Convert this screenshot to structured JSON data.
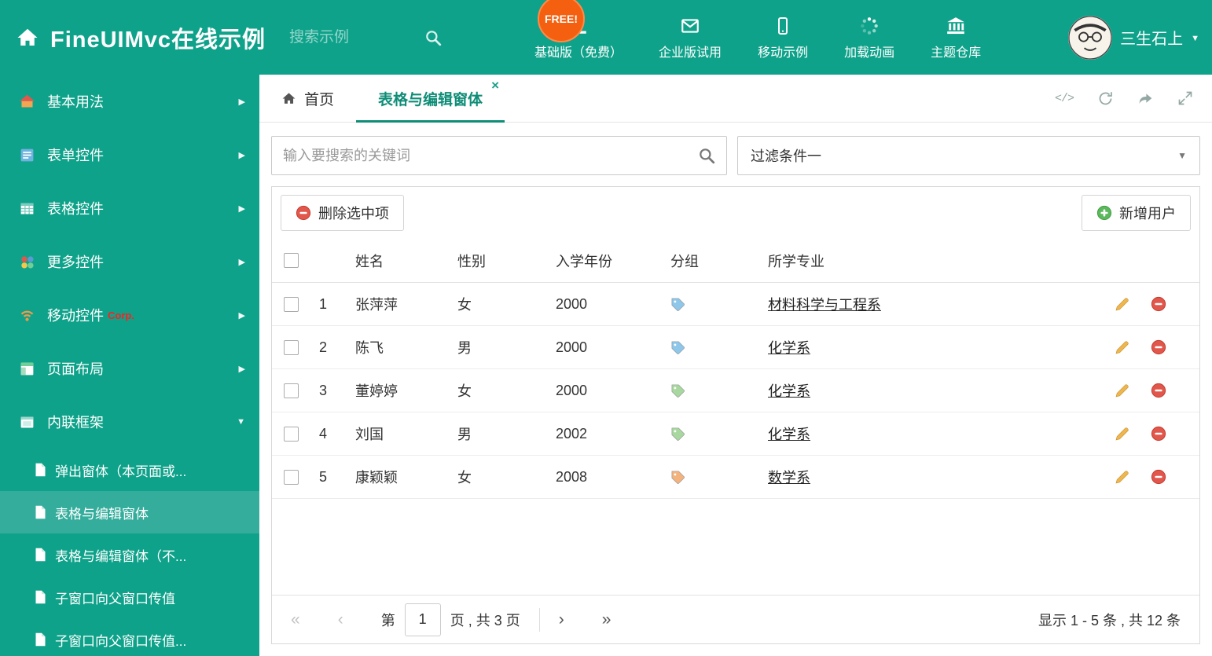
{
  "header": {
    "title": "FineUIMvc在线示例",
    "search_placeholder": "搜索示例",
    "free_badge": "FREE!",
    "nav": [
      {
        "label": "基础版（免费）"
      },
      {
        "label": "企业版试用"
      },
      {
        "label": "移动示例"
      },
      {
        "label": "加载动画"
      },
      {
        "label": "主题仓库"
      }
    ],
    "user_name": "三生石上"
  },
  "sidebar": {
    "items": [
      {
        "label": "基本用法"
      },
      {
        "label": "表单控件"
      },
      {
        "label": "表格控件"
      },
      {
        "label": "更多控件"
      },
      {
        "label": "移动控件",
        "tag": "Corp."
      },
      {
        "label": "页面布局"
      },
      {
        "label": "内联框架"
      }
    ],
    "subitems": [
      {
        "label": "弹出窗体（本页面或..."
      },
      {
        "label": "表格与编辑窗体"
      },
      {
        "label": "表格与编辑窗体（不..."
      },
      {
        "label": "子窗口向父窗口传值"
      },
      {
        "label": "子窗口向父窗口传值..."
      }
    ]
  },
  "tabs": {
    "home": "首页",
    "active": "表格与编辑窗体",
    "close": "×"
  },
  "filter": {
    "keyword_placeholder": "输入要搜索的关键词",
    "dropdown_value": "过滤条件一"
  },
  "toolbar": {
    "delete_label": "删除选中项",
    "add_label": "新增用户"
  },
  "table": {
    "headers": {
      "name": "姓名",
      "gender": "性别",
      "year": "入学年份",
      "group": "分组",
      "major": "所学专业"
    },
    "rows": [
      {
        "num": "1",
        "name": "张萍萍",
        "gender": "女",
        "year": "2000",
        "tag_color": "#8ec7ea",
        "major": "材料科学与工程系"
      },
      {
        "num": "2",
        "name": "陈飞",
        "gender": "男",
        "year": "2000",
        "tag_color": "#8ec7ea",
        "major": "化学系"
      },
      {
        "num": "3",
        "name": "董婷婷",
        "gender": "女",
        "year": "2000",
        "tag_color": "#a8d8a0",
        "major": "化学系"
      },
      {
        "num": "4",
        "name": "刘国",
        "gender": "男",
        "year": "2002",
        "tag_color": "#a8d8a0",
        "major": "化学系"
      },
      {
        "num": "5",
        "name": "康颖颖",
        "gender": "女",
        "year": "2008",
        "tag_color": "#f3b37e",
        "major": "数学系"
      }
    ]
  },
  "pagination": {
    "first": "«",
    "prev": "‹",
    "prefix": "第",
    "page": "1",
    "suffix": "页 , 共 3 页",
    "next": "›",
    "last": "»",
    "summary": "显示 1 - 5 条 , 共 12 条"
  }
}
